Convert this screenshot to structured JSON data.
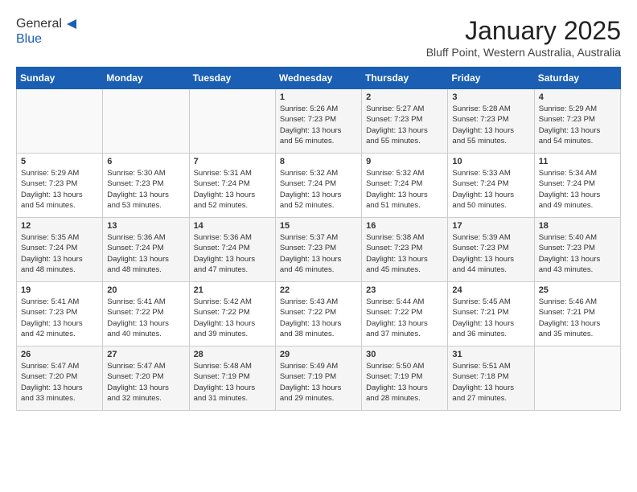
{
  "header": {
    "logo_line1": "General",
    "logo_line2": "Blue",
    "month_title": "January 2025",
    "location": "Bluff Point, Western Australia, Australia"
  },
  "days_of_week": [
    "Sunday",
    "Monday",
    "Tuesday",
    "Wednesday",
    "Thursday",
    "Friday",
    "Saturday"
  ],
  "weeks": [
    [
      {
        "num": "",
        "info": ""
      },
      {
        "num": "",
        "info": ""
      },
      {
        "num": "",
        "info": ""
      },
      {
        "num": "1",
        "info": "Sunrise: 5:26 AM\nSunset: 7:23 PM\nDaylight: 13 hours\nand 56 minutes."
      },
      {
        "num": "2",
        "info": "Sunrise: 5:27 AM\nSunset: 7:23 PM\nDaylight: 13 hours\nand 55 minutes."
      },
      {
        "num": "3",
        "info": "Sunrise: 5:28 AM\nSunset: 7:23 PM\nDaylight: 13 hours\nand 55 minutes."
      },
      {
        "num": "4",
        "info": "Sunrise: 5:29 AM\nSunset: 7:23 PM\nDaylight: 13 hours\nand 54 minutes."
      }
    ],
    [
      {
        "num": "5",
        "info": "Sunrise: 5:29 AM\nSunset: 7:23 PM\nDaylight: 13 hours\nand 54 minutes."
      },
      {
        "num": "6",
        "info": "Sunrise: 5:30 AM\nSunset: 7:23 PM\nDaylight: 13 hours\nand 53 minutes."
      },
      {
        "num": "7",
        "info": "Sunrise: 5:31 AM\nSunset: 7:24 PM\nDaylight: 13 hours\nand 52 minutes."
      },
      {
        "num": "8",
        "info": "Sunrise: 5:32 AM\nSunset: 7:24 PM\nDaylight: 13 hours\nand 52 minutes."
      },
      {
        "num": "9",
        "info": "Sunrise: 5:32 AM\nSunset: 7:24 PM\nDaylight: 13 hours\nand 51 minutes."
      },
      {
        "num": "10",
        "info": "Sunrise: 5:33 AM\nSunset: 7:24 PM\nDaylight: 13 hours\nand 50 minutes."
      },
      {
        "num": "11",
        "info": "Sunrise: 5:34 AM\nSunset: 7:24 PM\nDaylight: 13 hours\nand 49 minutes."
      }
    ],
    [
      {
        "num": "12",
        "info": "Sunrise: 5:35 AM\nSunset: 7:24 PM\nDaylight: 13 hours\nand 48 minutes."
      },
      {
        "num": "13",
        "info": "Sunrise: 5:36 AM\nSunset: 7:24 PM\nDaylight: 13 hours\nand 48 minutes."
      },
      {
        "num": "14",
        "info": "Sunrise: 5:36 AM\nSunset: 7:24 PM\nDaylight: 13 hours\nand 47 minutes."
      },
      {
        "num": "15",
        "info": "Sunrise: 5:37 AM\nSunset: 7:23 PM\nDaylight: 13 hours\nand 46 minutes."
      },
      {
        "num": "16",
        "info": "Sunrise: 5:38 AM\nSunset: 7:23 PM\nDaylight: 13 hours\nand 45 minutes."
      },
      {
        "num": "17",
        "info": "Sunrise: 5:39 AM\nSunset: 7:23 PM\nDaylight: 13 hours\nand 44 minutes."
      },
      {
        "num": "18",
        "info": "Sunrise: 5:40 AM\nSunset: 7:23 PM\nDaylight: 13 hours\nand 43 minutes."
      }
    ],
    [
      {
        "num": "19",
        "info": "Sunrise: 5:41 AM\nSunset: 7:23 PM\nDaylight: 13 hours\nand 42 minutes."
      },
      {
        "num": "20",
        "info": "Sunrise: 5:41 AM\nSunset: 7:22 PM\nDaylight: 13 hours\nand 40 minutes."
      },
      {
        "num": "21",
        "info": "Sunrise: 5:42 AM\nSunset: 7:22 PM\nDaylight: 13 hours\nand 39 minutes."
      },
      {
        "num": "22",
        "info": "Sunrise: 5:43 AM\nSunset: 7:22 PM\nDaylight: 13 hours\nand 38 minutes."
      },
      {
        "num": "23",
        "info": "Sunrise: 5:44 AM\nSunset: 7:22 PM\nDaylight: 13 hours\nand 37 minutes."
      },
      {
        "num": "24",
        "info": "Sunrise: 5:45 AM\nSunset: 7:21 PM\nDaylight: 13 hours\nand 36 minutes."
      },
      {
        "num": "25",
        "info": "Sunrise: 5:46 AM\nSunset: 7:21 PM\nDaylight: 13 hours\nand 35 minutes."
      }
    ],
    [
      {
        "num": "26",
        "info": "Sunrise: 5:47 AM\nSunset: 7:20 PM\nDaylight: 13 hours\nand 33 minutes."
      },
      {
        "num": "27",
        "info": "Sunrise: 5:47 AM\nSunset: 7:20 PM\nDaylight: 13 hours\nand 32 minutes."
      },
      {
        "num": "28",
        "info": "Sunrise: 5:48 AM\nSunset: 7:19 PM\nDaylight: 13 hours\nand 31 minutes."
      },
      {
        "num": "29",
        "info": "Sunrise: 5:49 AM\nSunset: 7:19 PM\nDaylight: 13 hours\nand 29 minutes."
      },
      {
        "num": "30",
        "info": "Sunrise: 5:50 AM\nSunset: 7:19 PM\nDaylight: 13 hours\nand 28 minutes."
      },
      {
        "num": "31",
        "info": "Sunrise: 5:51 AM\nSunset: 7:18 PM\nDaylight: 13 hours\nand 27 minutes."
      },
      {
        "num": "",
        "info": ""
      }
    ]
  ]
}
